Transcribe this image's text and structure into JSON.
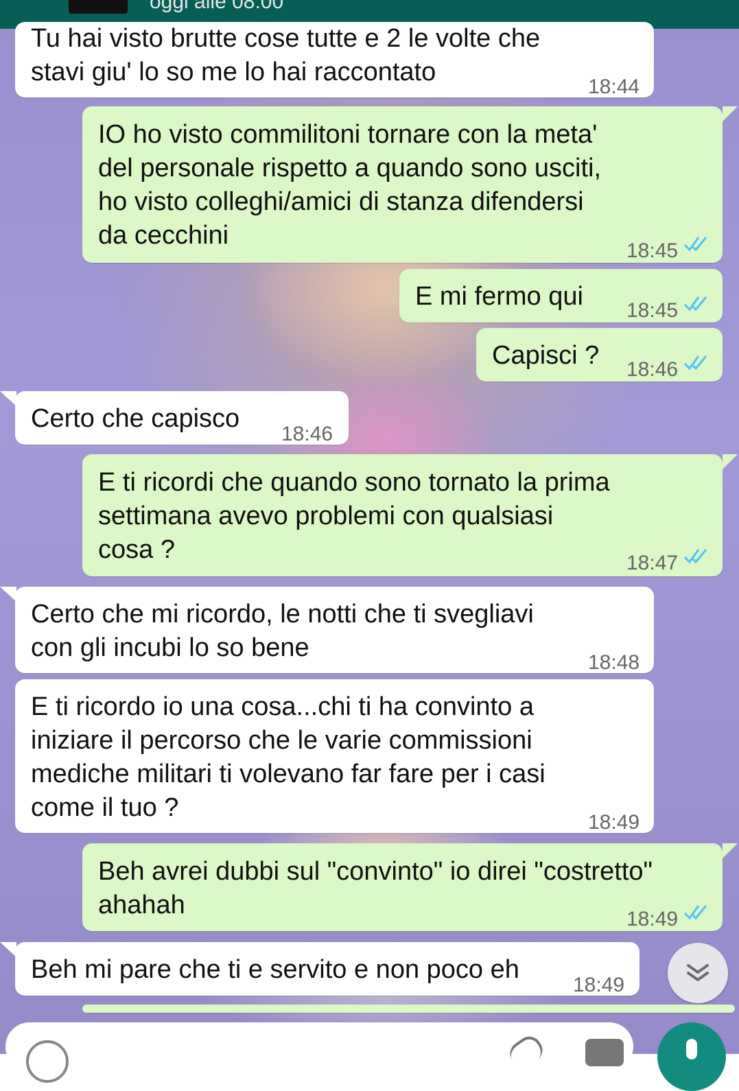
{
  "header": {
    "last_seen": "oggi alle 08:00"
  },
  "messages": [
    {
      "direction": "in",
      "text": "Tu hai visto brutte cose tutte e 2 le volte che\nstavi giu' lo so me lo hai raccontato",
      "time": "18:44"
    },
    {
      "direction": "out",
      "text": "IO ho visto commilitoni tornare con la meta'\ndel personale rispetto a quando sono usciti,\nho visto colleghi/amici di stanza difendersi\nda cecchini",
      "time": "18:45",
      "status": "read"
    },
    {
      "direction": "out",
      "text": "E mi fermo qui",
      "time": "18:45",
      "status": "read"
    },
    {
      "direction": "out",
      "text": "Capisci ?",
      "time": "18:46",
      "status": "read"
    },
    {
      "direction": "in",
      "text": "Certo che capisco",
      "time": "18:46"
    },
    {
      "direction": "out",
      "text": "E ti ricordi che quando sono tornato la prima\nsettimana avevo problemi con qualsiasi\ncosa ?",
      "time": "18:47",
      "status": "read"
    },
    {
      "direction": "in",
      "text": "Certo che mi ricordo, le notti che ti svegliavi\ncon gli incubi lo so bene",
      "time": "18:48"
    },
    {
      "direction": "in",
      "text": "E ti ricordo io una cosa...chi ti ha convinto a\niniziare il percorso che le varie commissioni\nmediche militari ti volevano far fare per i casi\ncome il tuo ?",
      "time": "18:49"
    },
    {
      "direction": "out",
      "text": "Beh avrei dubbi sul \"convinto\" io direi \"costretto\"\nahahah",
      "time": "18:49",
      "status": "read"
    },
    {
      "direction": "in",
      "text": "Beh mi pare che ti e servito e non poco eh",
      "time": "18:49"
    }
  ],
  "icons": {
    "read_receipt": "double-check-icon",
    "scroll_down": "chevron-double-down-icon",
    "emoji": "emoji-icon",
    "attach": "paperclip-icon",
    "camera": "camera-icon",
    "mic": "mic-icon"
  },
  "colors": {
    "header": "#075e54",
    "incoming_bubble": "#ffffff",
    "outgoing_bubble": "#dcf8c6",
    "read_check": "#4fc3f7",
    "mic_button": "#128c7e"
  }
}
